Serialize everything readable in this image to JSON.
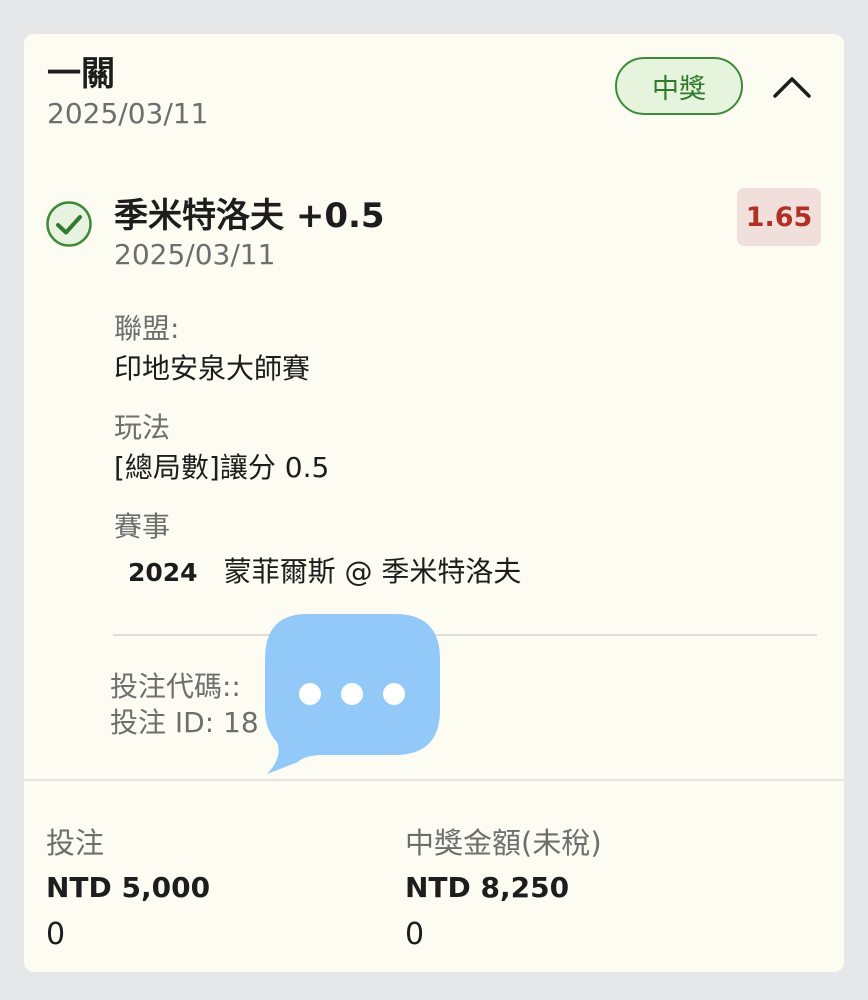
{
  "header": {
    "bet_type": "一關",
    "date": "2025/03/11",
    "status": "中獎",
    "collapse_icon": "chevron-up-icon"
  },
  "selection": {
    "icon": "check-circle-icon",
    "name": "季米特洛夫 +0.5",
    "date": "2025/03/11",
    "odds": "1.65",
    "league_label": "聯盟:",
    "league_value": "印地安泉大師賽",
    "market_label": "玩法",
    "market_value": "[總局數]讓分 0.5",
    "event_label": "賽事",
    "event_year": "2024",
    "event_value": "蒙菲爾斯 @ 季米特洛夫"
  },
  "bet_info": {
    "code_label": "投注代碼::",
    "id_label": "投注 ID: 18"
  },
  "footer": {
    "stake_label": "投注",
    "stake_value": "NTD 5,000",
    "stake_extra": "0",
    "win_label": "中獎金額(未稅)",
    "win_value": "NTD 8,250",
    "win_extra": "0"
  },
  "overlay": {
    "icon": "chat-bubble-icon"
  },
  "colors": {
    "page_bg": "#e6e7e9",
    "card_bg": "#fdfcf3",
    "win_green": "#3e8a3a",
    "odds_red": "#b03026",
    "odds_bg": "#f1dfdb",
    "bubble_blue": "#92c9f9"
  }
}
